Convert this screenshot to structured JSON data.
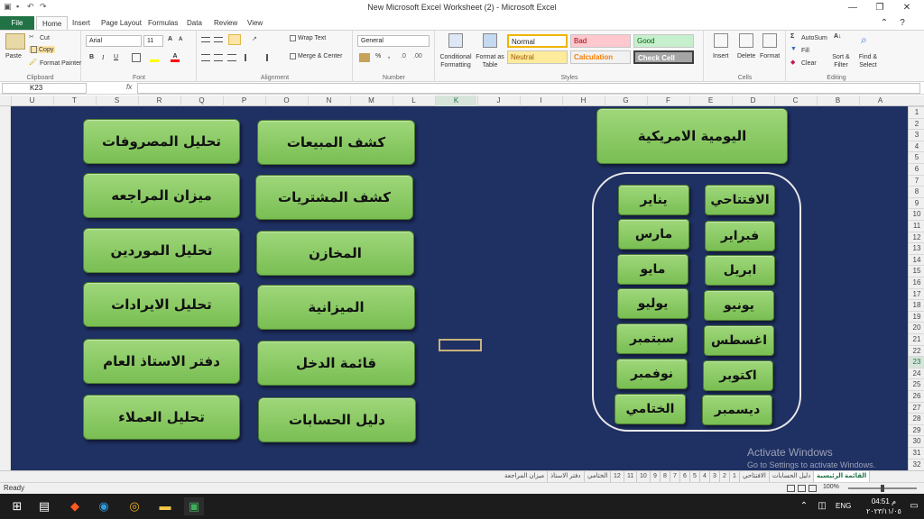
{
  "window": {
    "title": "New Microsoft Excel Worksheet (2)  -  Microsoft Excel",
    "minimize": "—",
    "restore": "❐",
    "close": "✕",
    "help": "?",
    "ribbon_toggle": "⌃"
  },
  "tabs": [
    "File",
    "Home",
    "Insert",
    "Page Layout",
    "Formulas",
    "Data",
    "Review",
    "View"
  ],
  "ribbon": {
    "clipboard": {
      "paste": "Paste",
      "cut": "Cut",
      "copy": "Copy",
      "format_painter": "Format Painter",
      "label": "Clipboard"
    },
    "font": {
      "name": "Arial",
      "size": "11",
      "label": "Font",
      "bold": "B",
      "italic": "I",
      "underline": "U",
      "grow": "A",
      "shrink": "A"
    },
    "alignment": {
      "wrap": "Wrap Text",
      "merge": "Merge & Center",
      "label": "Alignment"
    },
    "number": {
      "format": "General",
      "percent": "%",
      "comma": ",",
      "label": "Number"
    },
    "styles": {
      "conditional": "Conditional Formatting",
      "format_table": "Format as Table",
      "normal": "Normal",
      "bad": "Bad",
      "good": "Good",
      "neutral": "Neutral",
      "calculation": "Calculation",
      "check_cell": "Check Cell",
      "label": "Styles"
    },
    "cells": {
      "insert": "Insert",
      "delete": "Delete",
      "format": "Format",
      "label": "Cells"
    },
    "editing": {
      "autosum": "AutoSum",
      "fill": "Fill",
      "clear": "Clear",
      "sort": "Sort & Filter",
      "find": "Find & Select",
      "label": "Editing"
    },
    "colors": {
      "normal_border": "#f0b400",
      "bad_bg": "#ffc7ce",
      "bad_fg": "#9c0006",
      "good_bg": "#c6efce",
      "good_fg": "#006100",
      "neutral_bg": "#ffeb9c",
      "neutral_fg": "#9c5700",
      "calc_fg": "#fa7d00",
      "check_bg": "#a5a5a5"
    }
  },
  "formula_bar": {
    "name_box": "K23",
    "fx": "fx",
    "value": ""
  },
  "columns": [
    "U",
    "T",
    "S",
    "R",
    "Q",
    "P",
    "O",
    "N",
    "M",
    "L",
    "K",
    "J",
    "I",
    "H",
    "G",
    "F",
    "E",
    "D",
    "C",
    "B",
    "A"
  ],
  "rows": [
    "1",
    "2",
    "3",
    "4",
    "5",
    "6",
    "7",
    "8",
    "9",
    "10",
    "11",
    "12",
    "13",
    "14",
    "15",
    "16",
    "17",
    "18",
    "19",
    "20",
    "21",
    "22",
    "23",
    "24",
    "25",
    "26",
    "27",
    "28",
    "29",
    "30",
    "31",
    "32"
  ],
  "selected": {
    "column": "K",
    "row": "23"
  },
  "buttons_left": [
    "تحليل المصروفات",
    "ميزان المراجعه",
    "تحليل الموردين",
    "تحليل الايرادات",
    "دفتر الاستاذ العام",
    "تحليل العملاء"
  ],
  "buttons_middle": [
    "كشف المبيعات",
    "كشف المشتريات",
    "المخازن",
    "الميزانية",
    "قائمة الدخل",
    "دليل الحسابات"
  ],
  "header_button": "اليومية الامريكية",
  "months_right": [
    "الافتتاحي",
    "فبراير",
    "ابريل",
    "يونيو",
    "اغسطس",
    "اكتوبر",
    "ديسمبر"
  ],
  "months_left": [
    "يناير",
    "مارس",
    "مايو",
    "يوليو",
    "سبتمبر",
    "نوفمبر",
    "الختامي"
  ],
  "sheet_tabs": [
    "القائمة الرئيسية",
    "دليل الحسابات",
    "الافتتاحي",
    "1",
    "2",
    "3",
    "4",
    "5",
    "6",
    "7",
    "8",
    "9",
    "10",
    "11",
    "12",
    "الختامي",
    "دفتر الاستاذ",
    "ميزان المراجعة"
  ],
  "activate": {
    "line1": "Activate Windows",
    "line2": "Go to Settings to activate Windows."
  },
  "status": {
    "ready": "Ready",
    "zoom": "100%"
  },
  "taskbar": {
    "lang": "ENG",
    "time": "04:51 م",
    "date": "٢٠٢٣/١١/٠٥"
  }
}
